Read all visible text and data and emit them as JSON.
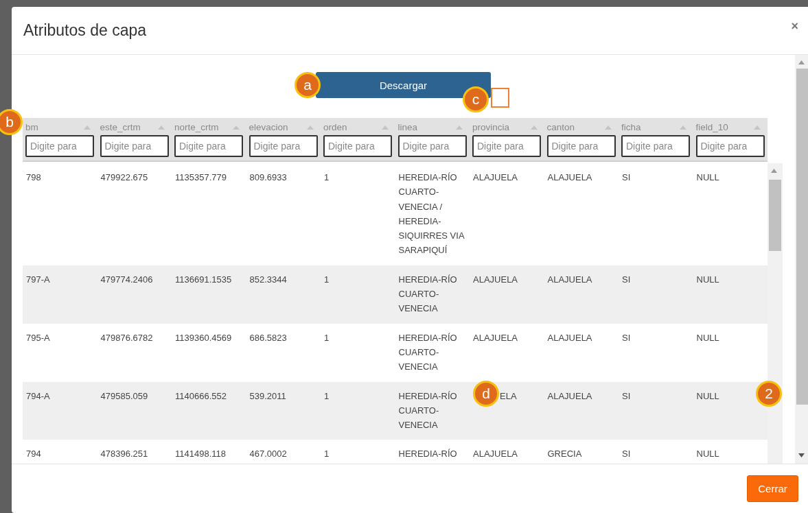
{
  "dialog": {
    "title": "Atributos de capa",
    "close": "×"
  },
  "download_button": "Descargar",
  "table": {
    "columns": [
      {
        "label": "bm",
        "placeholder": "Digite para"
      },
      {
        "label": "este_crtm",
        "placeholder": "Digite para"
      },
      {
        "label": "norte_crtm",
        "placeholder": "Digite para"
      },
      {
        "label": "elevacion",
        "placeholder": "Digite para"
      },
      {
        "label": "orden",
        "placeholder": "Digite para"
      },
      {
        "label": "linea",
        "placeholder": "Digite para"
      },
      {
        "label": "provincia",
        "placeholder": "Digite para"
      },
      {
        "label": "canton",
        "placeholder": "Digite para"
      },
      {
        "label": "ficha",
        "placeholder": "Digite para"
      },
      {
        "label": "field_10",
        "placeholder": "Digite para"
      }
    ],
    "rows": [
      [
        "798",
        "479922.675",
        "1135357.779",
        "809.6933",
        "1",
        "HEREDIA-RÍO CUARTO-VENECIA / HEREDIA-SIQUIRRES VIA SARAPIQUÍ",
        "ALAJUELA",
        "ALAJUELA",
        "SI",
        "NULL"
      ],
      [
        "797-A",
        "479774.2406",
        "1136691.1535",
        "852.3344",
        "1",
        "HEREDIA-RÍO CUARTO-VENECIA",
        "ALAJUELA",
        "ALAJUELA",
        "SI",
        "NULL"
      ],
      [
        "795-A",
        "479876.6782",
        "1139360.4569",
        "686.5823",
        "1",
        "HEREDIA-RÍO CUARTO-VENECIA",
        "ALAJUELA",
        "ALAJUELA",
        "SI",
        "NULL"
      ],
      [
        "794-A",
        "479585.059",
        "1140666.552",
        "539.2011",
        "1",
        "HEREDIA-RÍO CUARTO-VENECIA",
        {
          "text": "ELA",
          "kind": "behind-callout"
        },
        "ALAJUELA",
        "SI",
        "NULL"
      ],
      [
        "794",
        "478396.251",
        "1141498.118",
        "467.0002",
        "1",
        "HEREDIA-RÍO",
        "ALAJUELA",
        "GRECIA",
        "SI",
        "NULL"
      ]
    ]
  },
  "close_button": "Cerrar",
  "callouts": [
    {
      "label": "a"
    },
    {
      "label": "b"
    },
    {
      "label": "c"
    },
    {
      "label": "d"
    },
    {
      "label": "2"
    }
  ]
}
